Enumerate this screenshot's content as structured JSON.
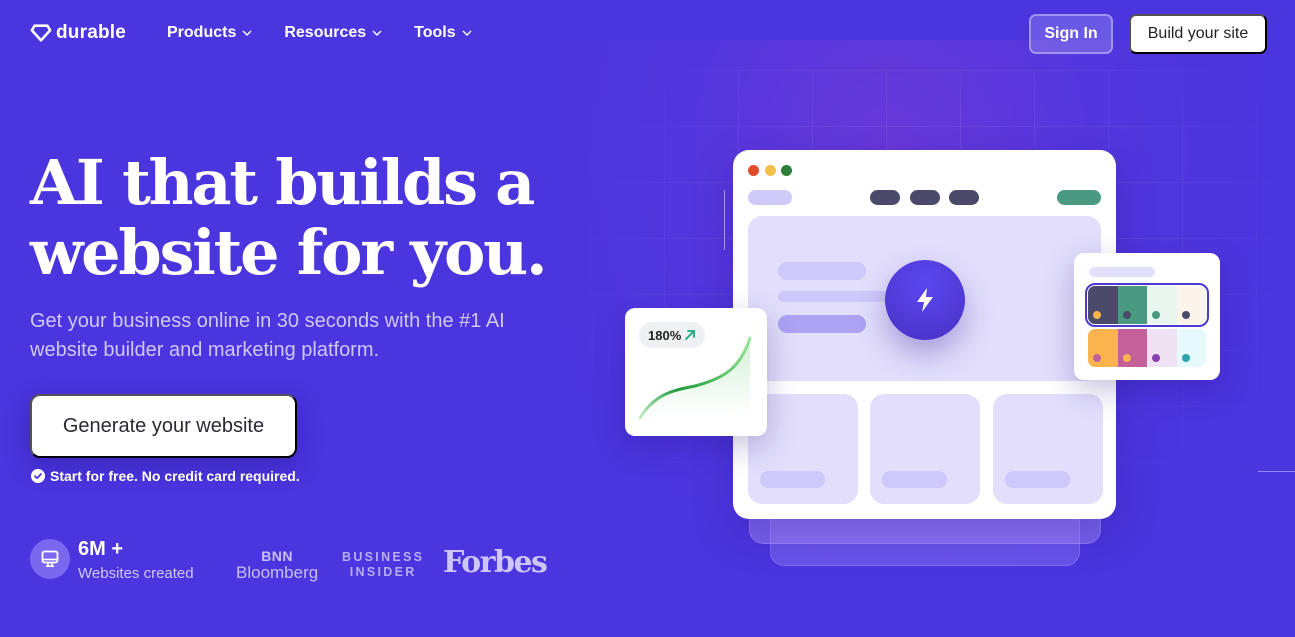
{
  "nav": {
    "logo_text": "durable",
    "links": [
      {
        "label": "Products"
      },
      {
        "label": "Resources"
      },
      {
        "label": "Tools"
      }
    ],
    "sign_in_label": "Sign In",
    "build_site_label": "Build your site"
  },
  "hero": {
    "title_line1": "AI that builds a",
    "title_line2": "website for you.",
    "subtitle": "Get your business online in 30 seconds with the #1 AI website builder and marketing platform.",
    "cta_label": "Generate your website",
    "free_note": "Start for free. No credit card required."
  },
  "stats": {
    "value": "6M +",
    "label": "Websites created"
  },
  "press": {
    "bnn_top": "BNN",
    "bnn_bottom": "Bloomberg",
    "bi_top": "BUSINESS",
    "bi_bottom": "INSIDER",
    "forbes": "Forbes"
  },
  "illustration": {
    "growth_badge": "180%",
    "window_dots": [
      "#e24a2b",
      "#f3c04a",
      "#2f7d3a"
    ],
    "nav_pill_colors": {
      "logo": "#d0caf9",
      "links": "#4b4a6b",
      "button": "#4a9a82"
    },
    "palettes": [
      {
        "selected": true,
        "swatches": [
          {
            "bg": "#4b4a6b",
            "dot": "#f9b44c"
          },
          {
            "bg": "#4a9a82",
            "dot": "#4b4a6b"
          },
          {
            "bg": "#e9f5ef",
            "dot": "#4a9a82"
          },
          {
            "bg": "#faf4ea",
            "dot": "#4b4a6b"
          }
        ]
      },
      {
        "selected": false,
        "swatches": [
          {
            "bg": "#fbb44d",
            "dot": "#c4619a"
          },
          {
            "bg": "#c4619a",
            "dot": "#fbb44d"
          },
          {
            "bg": "#efe2f3",
            "dot": "#8a3fb0"
          },
          {
            "bg": "#e6f9fb",
            "dot": "#2aa3ae"
          }
        ]
      }
    ]
  },
  "colors": {
    "background": "#4a35de",
    "accent_text": "#cfc8fb"
  }
}
